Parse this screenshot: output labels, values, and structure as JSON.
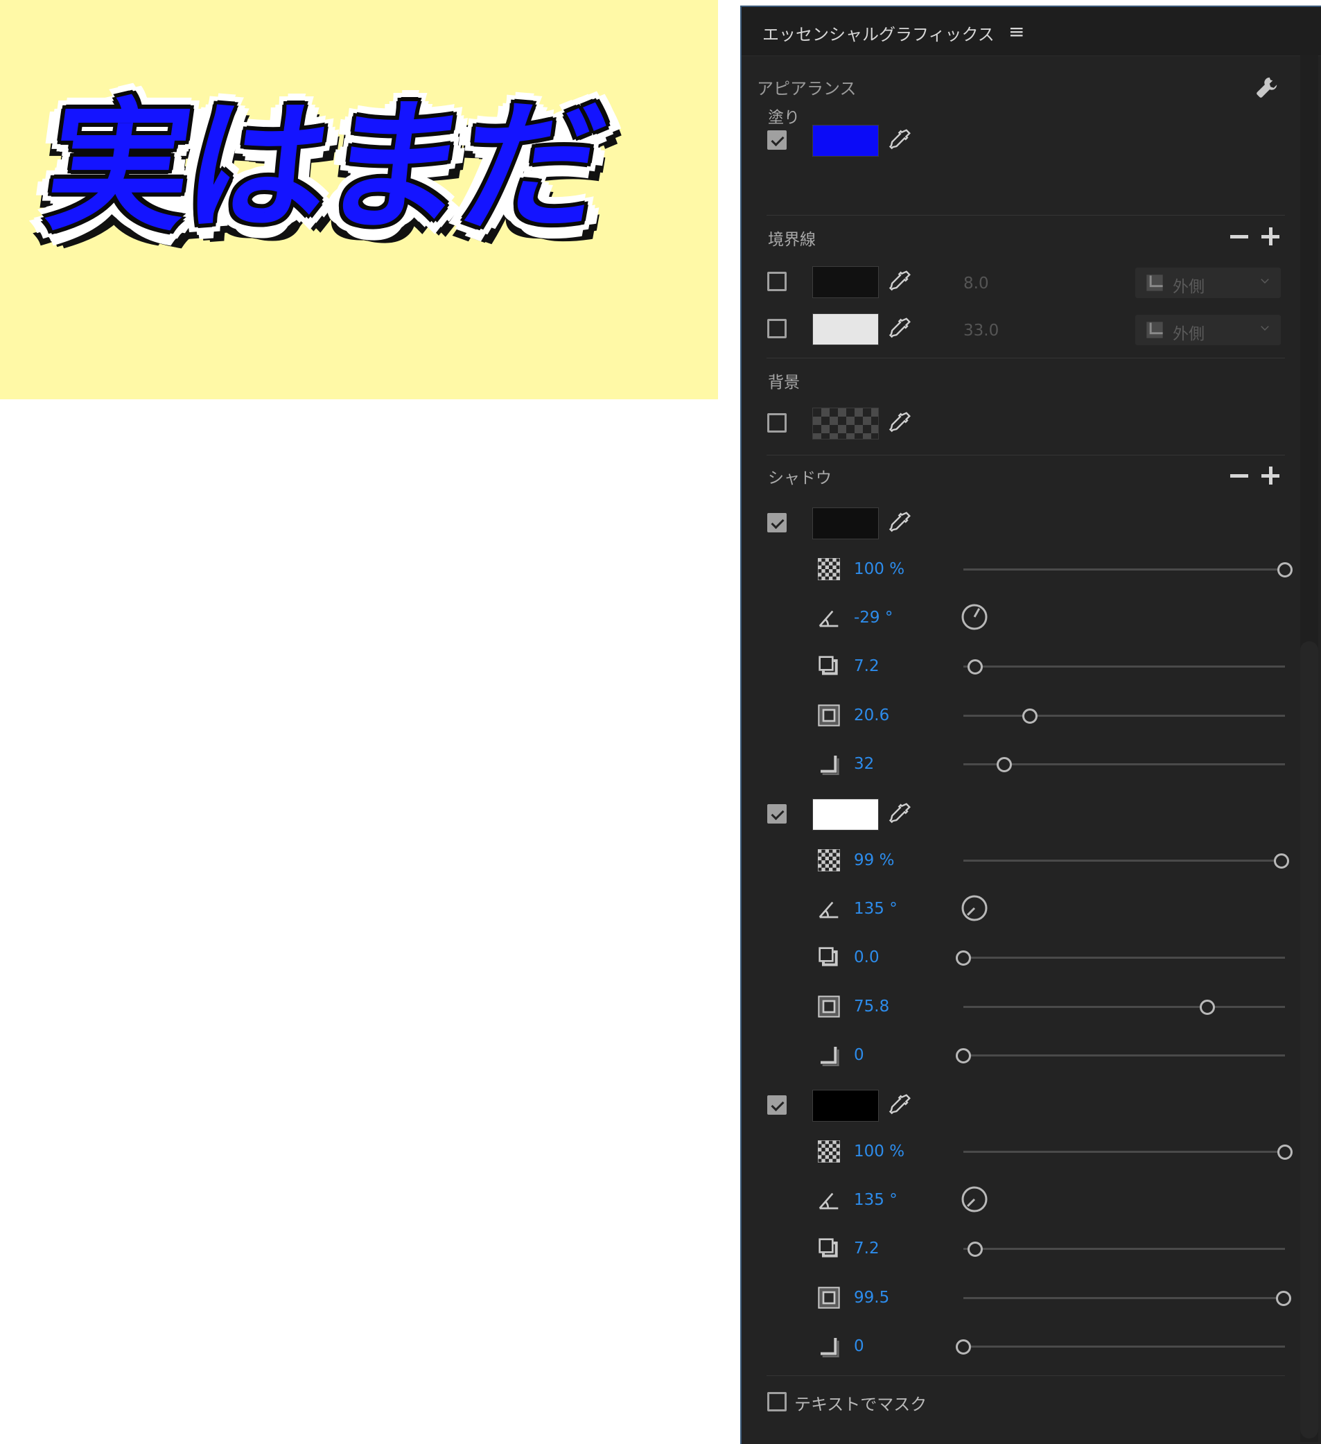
{
  "preview": {
    "title_text": "実はまだ",
    "background": "#fff9a6",
    "text_fill": "#1414ff"
  },
  "panel": {
    "title": "エッセンシャルグラフィックス",
    "menu_icon": "hamburger-menu-icon",
    "appearance_label": "アピアランス",
    "settings_icon": "wrench-icon",
    "fill": {
      "label": "塗り",
      "checked": true,
      "color": "#0b0bf7"
    },
    "stroke": {
      "label": "境界線",
      "items": [
        {
          "checked": false,
          "color": "#111111",
          "width": "8.0",
          "position": "外側"
        },
        {
          "checked": false,
          "color": "#e6e6e6",
          "width": "33.0",
          "position": "外側"
        }
      ]
    },
    "background": {
      "label": "背景",
      "checked": false,
      "color": "#444444"
    },
    "shadow": {
      "label": "シャドウ",
      "items": [
        {
          "checked": true,
          "color": "#0f0f0f",
          "opacity": "100 %",
          "angle": "-29 °",
          "distance": "7.2",
          "size": "20.6",
          "blur": "32",
          "opacity_frac": 1.0,
          "angle_deg": -29,
          "distance_frac": 0.036,
          "size_frac": 0.206,
          "blur_frac": 0.128
        },
        {
          "checked": true,
          "color": "#ffffff",
          "opacity": "99 %",
          "angle": "135 °",
          "distance": "0.0",
          "size": "75.8",
          "blur": "0",
          "opacity_frac": 0.99,
          "angle_deg": 135,
          "distance_frac": 0.0,
          "size_frac": 0.758,
          "blur_frac": 0.0
        },
        {
          "checked": true,
          "color": "#000000",
          "opacity": "100 %",
          "angle": "135 °",
          "distance": "7.2",
          "size": "99.5",
          "blur": "0",
          "opacity_frac": 1.0,
          "angle_deg": 135,
          "distance_frac": 0.036,
          "size_frac": 0.995,
          "blur_frac": 0.0
        }
      ]
    },
    "mask": {
      "label": "テキストでマスク",
      "checked": false
    }
  }
}
